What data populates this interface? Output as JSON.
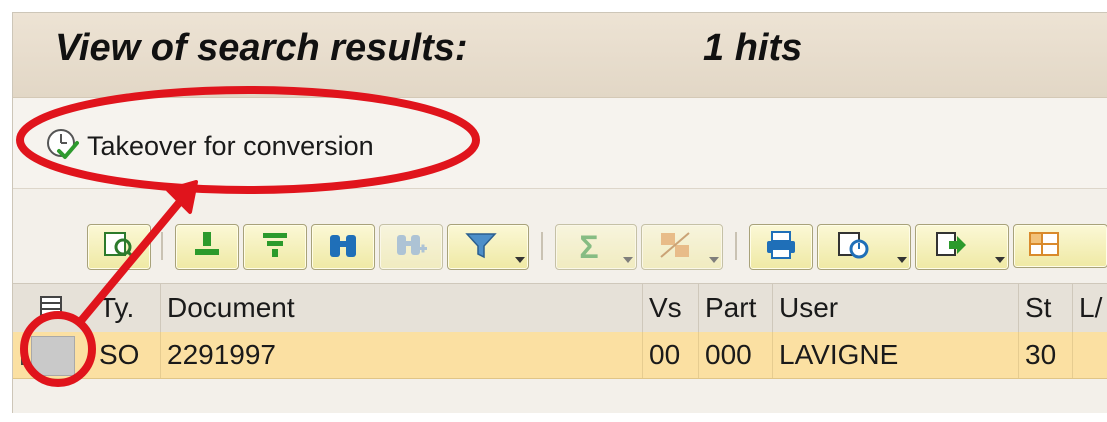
{
  "header": {
    "title": "View of search results:",
    "hits": "1 hits"
  },
  "app_toolbar": {
    "takeover_label": "Takeover for conversion",
    "takeover_icon": "clock-check-icon"
  },
  "alv_toolbar": {
    "buttons": [
      {
        "name": "details-button",
        "icon": "magnifier-doc-icon"
      },
      {
        "name": "sort-ascending-button",
        "icon": "sort-asc-icon"
      },
      {
        "name": "sort-descending-button",
        "icon": "sort-desc-icon"
      },
      {
        "name": "find-button",
        "icon": "binoculars-icon"
      },
      {
        "name": "find-next-button",
        "icon": "binoculars-plus-icon"
      },
      {
        "name": "filter-button",
        "icon": "filter-icon"
      },
      {
        "name": "total-button",
        "icon": "sigma-icon"
      },
      {
        "name": "subtotal-button",
        "icon": "subtotal-icon"
      },
      {
        "name": "print-preview-button",
        "icon": "printer-icon"
      },
      {
        "name": "views-button",
        "icon": "views-icon"
      },
      {
        "name": "export-button",
        "icon": "export-icon"
      },
      {
        "name": "layout-button",
        "icon": "layout-grid-icon"
      }
    ]
  },
  "grid": {
    "columns": [
      "Ty.",
      "Document",
      "Vs",
      "Part",
      "User",
      "St",
      "L/"
    ],
    "rows": [
      {
        "type": "SO",
        "document": "2291997",
        "version": "00",
        "part": "000",
        "user": "LAVIGNE",
        "status": "30",
        "l": ""
      }
    ]
  },
  "colors": {
    "title_bar": "#e6dccb",
    "selected_row": "#fbe0a2",
    "annotation": "#e0141c",
    "toolbar_button": "#f3eeb6"
  }
}
